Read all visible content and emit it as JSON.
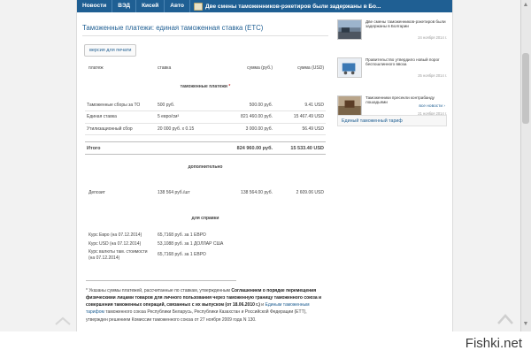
{
  "topnav": {
    "items": [
      "Новости",
      "ВЭД",
      "Кисей",
      "Авто"
    ],
    "ticker": "Две смены таможенников-рэкетиров были задержаны в Бо..."
  },
  "article": {
    "title": "Таможенные платежи: единая таможенная ставка (ЕТС)",
    "print_button": "версия для печати"
  },
  "table": {
    "columns": [
      "платеж",
      "ставка",
      "сумма (руб.)",
      "сумма (USD)"
    ],
    "section_customs": "таможенные платежи",
    "rows": [
      {
        "name": "Таможенные сборы за ТО",
        "rate": "500 руб.",
        "rub": "500.00 руб.",
        "usd": "9.41 USD"
      },
      {
        "name": "Единая ставка",
        "rate": "5 евро/см³",
        "rub": "821 460.00 руб.",
        "usd": "15 467.49 USD"
      },
      {
        "name": "Утилизационный сбор",
        "rate": "20 000 руб. х 0.15",
        "rub": "3 000.00 руб.",
        "usd": "56.49 USD"
      }
    ],
    "total": {
      "label": "Итого",
      "rub": "824 960.00 руб.",
      "usd": "15 533.40 USD"
    },
    "section_extra": "дополнительно",
    "deposit": {
      "name": "Депозит",
      "rate": "138 564 руб./шт",
      "rub": "138 564.00 руб.",
      "usd": "2 609.06 USD"
    },
    "section_ref": "для справки",
    "refs": [
      {
        "name": "Курс Евро (на 07.12.2014)",
        "value": "65,7168 руб. за 1 ЕВРО"
      },
      {
        "name": "Курс USD (на 07.12.2014)",
        "value": "53,1088 руб. за 1 ДОЛЛАР США"
      },
      {
        "name": "Курс валюты там. стоимости (на 07.12.2014)",
        "value": "65,7168 руб. за 1 ЕВРО"
      }
    ]
  },
  "footnote": {
    "p1": "* Указаны суммы платежей, рассчитанные по ставкам, утвержденным",
    "p2": "Соглашением о порядке перемещения физическими лицами товаров для личного пользования через таможенную границу таможенного союза и совершения таможенных операций, связанных с их выпуском (от 18.06.2010 г.)",
    "p3": "и",
    "p4": "Единым таможенным тарифом",
    "p5": "таможенного союза Республики Беларусь, Республики Казахстан и Российской Федерации (ЕТТ), утвержден решением Комиссии таможенного союза от 27 ноября 2009 года N 130."
  },
  "sidebar": {
    "news": [
      {
        "text": "Две смены таможенников-рэкетиров были задержаны в Болгарии",
        "date": "24 ноября 2014 г."
      },
      {
        "text": "Правительство утвердило новый порог беспошлинного ввоза",
        "date": "25 ноября 2014 г."
      },
      {
        "text": "Таможенники пресекли контрабанду лошадьями",
        "date": "21 ноября 2014 г."
      }
    ],
    "all_news": "все новости",
    "block_title": "Единый таможенный тариф"
  },
  "watermark": "Fishki.net",
  "colors": {
    "nav": "#1f5f93",
    "link": "#1f5f93"
  }
}
